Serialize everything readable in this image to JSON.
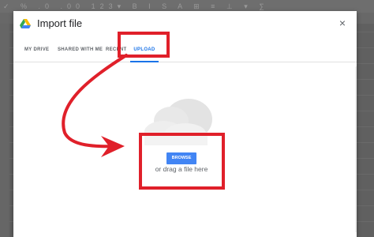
{
  "background": {
    "toolbar_glyphs": "✓ % .0 .00 123▾ B I S A ⊞ ≡ ⊥ ▾ ∑"
  },
  "dialog": {
    "title": "Import file",
    "close_icon": "×",
    "tabs": [
      {
        "label": "My Drive",
        "active": false
      },
      {
        "label": "Shared with me",
        "active": false
      },
      {
        "label": "Recent",
        "active": false
      },
      {
        "label": "Upload",
        "active": true
      }
    ],
    "upload": {
      "browse_label": "BROWSE",
      "drag_text": "or drag a file here"
    }
  },
  "colors": {
    "accent": "#1a73e8",
    "browse_button": "#4285f4",
    "annotation": "#e0202a"
  }
}
